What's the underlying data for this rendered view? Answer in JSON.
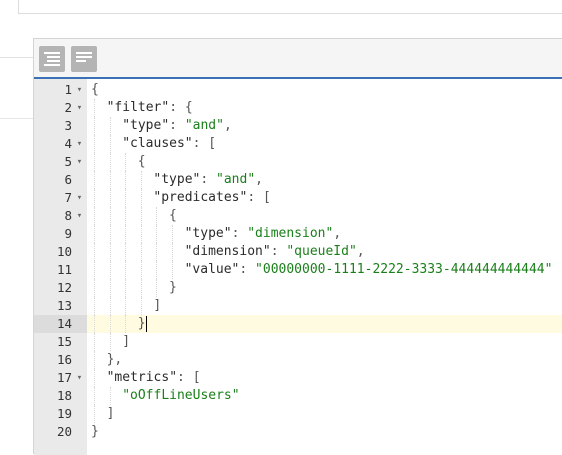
{
  "toolbar": {
    "buttons": [
      {
        "name": "format-button",
        "icon": "format-align-icon"
      },
      {
        "name": "compact-button",
        "icon": "compact-align-icon"
      }
    ]
  },
  "active_line": 14,
  "lines": [
    {
      "n": "1",
      "fold": true,
      "indent": 0,
      "parts": [
        [
          "p",
          "{"
        ]
      ]
    },
    {
      "n": "2",
      "fold": true,
      "indent": 1,
      "parts": [
        [
          "k",
          "\"filter\""
        ],
        [
          "p",
          ": {"
        ]
      ]
    },
    {
      "n": "3",
      "fold": false,
      "indent": 2,
      "parts": [
        [
          "k",
          "\"type\""
        ],
        [
          "p",
          ": "
        ],
        [
          "s",
          "\"and\""
        ],
        [
          "p",
          ","
        ]
      ]
    },
    {
      "n": "4",
      "fold": true,
      "indent": 2,
      "parts": [
        [
          "k",
          "\"clauses\""
        ],
        [
          "p",
          ": ["
        ]
      ]
    },
    {
      "n": "5",
      "fold": true,
      "indent": 3,
      "parts": [
        [
          "p",
          "{"
        ]
      ]
    },
    {
      "n": "6",
      "fold": false,
      "indent": 4,
      "parts": [
        [
          "k",
          "\"type\""
        ],
        [
          "p",
          ": "
        ],
        [
          "s",
          "\"and\""
        ],
        [
          "p",
          ","
        ]
      ]
    },
    {
      "n": "7",
      "fold": true,
      "indent": 4,
      "parts": [
        [
          "k",
          "\"predicates\""
        ],
        [
          "p",
          ": ["
        ]
      ]
    },
    {
      "n": "8",
      "fold": true,
      "indent": 5,
      "parts": [
        [
          "p",
          "{"
        ]
      ]
    },
    {
      "n": "9",
      "fold": false,
      "indent": 6,
      "parts": [
        [
          "k",
          "\"type\""
        ],
        [
          "p",
          ": "
        ],
        [
          "s",
          "\"dimension\""
        ],
        [
          "p",
          ","
        ]
      ]
    },
    {
      "n": "10",
      "fold": false,
      "indent": 6,
      "parts": [
        [
          "k",
          "\"dimension\""
        ],
        [
          "p",
          ": "
        ],
        [
          "s",
          "\"queueId\""
        ],
        [
          "p",
          ","
        ]
      ]
    },
    {
      "n": "11",
      "fold": false,
      "indent": 6,
      "parts": [
        [
          "k",
          "\"value\""
        ],
        [
          "p",
          ": "
        ],
        [
          "s",
          "\"00000000-1111-2222-3333-444444444444\""
        ]
      ]
    },
    {
      "n": "12",
      "fold": false,
      "indent": 5,
      "parts": [
        [
          "p",
          "}"
        ]
      ]
    },
    {
      "n": "13",
      "fold": false,
      "indent": 4,
      "parts": [
        [
          "p",
          "]"
        ]
      ]
    },
    {
      "n": "14",
      "fold": false,
      "indent": 3,
      "parts": [
        [
          "p",
          "}"
        ]
      ]
    },
    {
      "n": "15",
      "fold": false,
      "indent": 2,
      "parts": [
        [
          "p",
          "]"
        ]
      ]
    },
    {
      "n": "16",
      "fold": false,
      "indent": 1,
      "parts": [
        [
          "p",
          "},"
        ]
      ]
    },
    {
      "n": "17",
      "fold": true,
      "indent": 1,
      "parts": [
        [
          "k",
          "\"metrics\""
        ],
        [
          "p",
          ": ["
        ]
      ]
    },
    {
      "n": "18",
      "fold": false,
      "indent": 2,
      "parts": [
        [
          "s",
          "\"oOffLineUsers\""
        ]
      ]
    },
    {
      "n": "19",
      "fold": false,
      "indent": 1,
      "parts": [
        [
          "p",
          "]"
        ]
      ]
    },
    {
      "n": "20",
      "fold": false,
      "indent": 0,
      "parts": [
        [
          "p",
          "}"
        ]
      ]
    }
  ]
}
